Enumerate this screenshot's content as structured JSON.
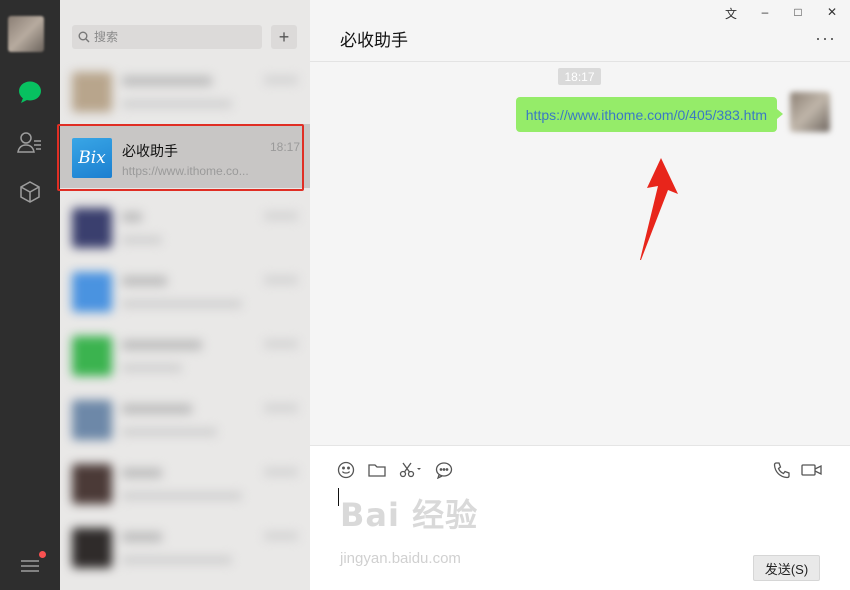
{
  "window": {
    "controls": [
      "⽂",
      "–",
      "□",
      "✕"
    ]
  },
  "sidebar": {
    "icons": [
      "chat-icon",
      "contacts-icon",
      "favorites-icon",
      "menu-icon"
    ],
    "active_color": "#07c160"
  },
  "search": {
    "placeholder": "搜索",
    "add_label": "+"
  },
  "conversations": {
    "active": {
      "name": "必收助手",
      "time": "18:17",
      "preview": "https://www.ithome.co...",
      "logo_text": "Bix"
    }
  },
  "chat": {
    "title": "必收助手",
    "more_label": "···",
    "timestamp": "18:17",
    "message": "https://www.ithome.com/0/405/383.htm",
    "bubble_color": "#95ec69"
  },
  "composer": {
    "tools": [
      "emoji-icon",
      "folder-icon",
      "scissors-icon",
      "chat-history-icon",
      "phone-icon",
      "video-icon"
    ],
    "send_label": "发送(S)"
  },
  "watermark": {
    "brand": "Bai 经验",
    "site": "jingyan.baidu.com"
  },
  "annotation": {
    "highlight_color": "#e02e24"
  }
}
